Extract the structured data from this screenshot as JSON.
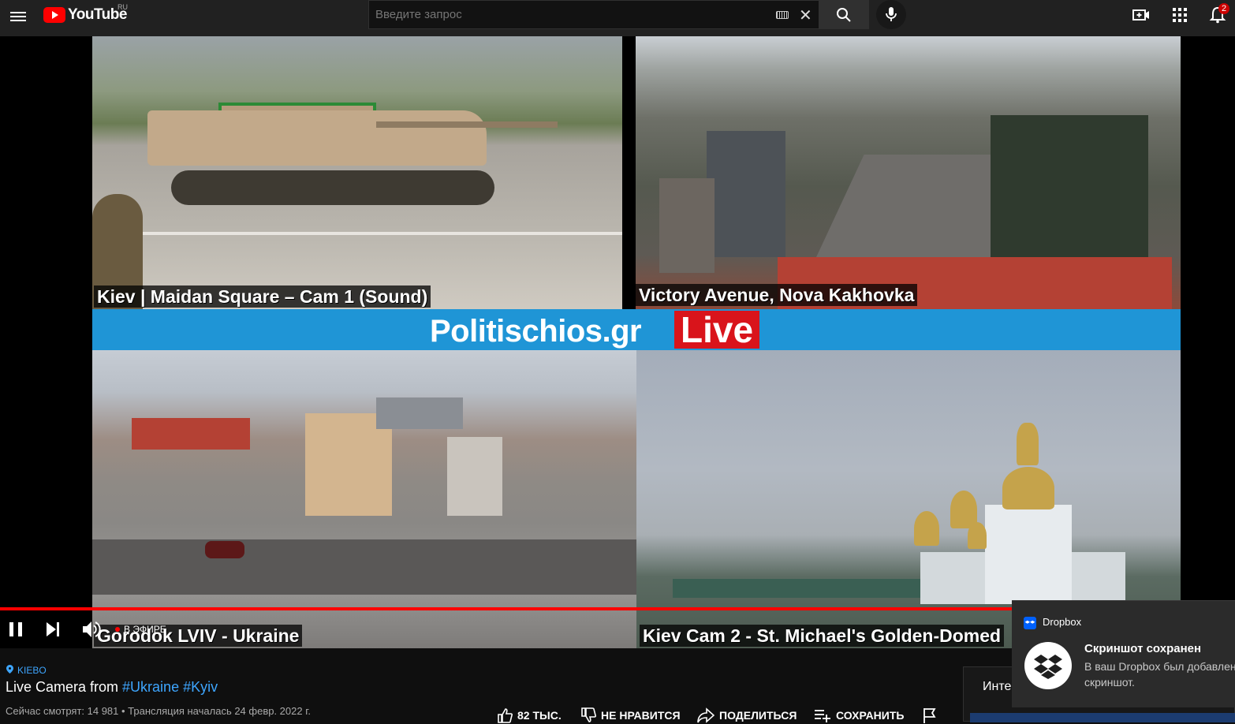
{
  "masthead": {
    "logo_text": "YouTube",
    "country_code": "RU",
    "search_placeholder": "Введите запрос",
    "notification_count": "2",
    "icons": [
      "menu-icon",
      "keyboard-icon",
      "clear-icon",
      "search-icon",
      "mic-icon",
      "create-video-icon",
      "apps-icon",
      "bell-icon"
    ]
  },
  "video": {
    "banner_site": "Politischios.gr",
    "banner_live": "Live",
    "cam_labels": [
      "Kiev | Maidan Square – Cam 1 (Sound)",
      "Victory Avenue, Nova Kakhovka",
      "Gorodok LVIV - Ukraine",
      "Kiev Cam 2 - St. Michael's Golden-Domed"
    ],
    "progress_fraction": 0.995,
    "live_label": "В ЭФИРЕ",
    "accent_color": "#ff0000",
    "banner_color": "#1f95d6"
  },
  "info": {
    "location": "KIEBO",
    "title_prefix": "Live Camera from ",
    "title_tag_1": "#Ukraine",
    "title_tag_2": "#Kyiv",
    "meta": "Сейчас смотрят: 14 981 • Трансляция началась 24 февр. 2022 г.",
    "actions": {
      "like": "82 ТЫС.",
      "dislike": "НЕ НРАВИТСЯ",
      "share": "ПОДЕЛИТЬСЯ",
      "save": "СОХРАНИТЬ"
    },
    "side_label": "Инте"
  },
  "toast": {
    "brand": "Dropbox",
    "title": "Скриншот сохранен",
    "body": "В ваш Dropbox был добавлен скриншот."
  }
}
